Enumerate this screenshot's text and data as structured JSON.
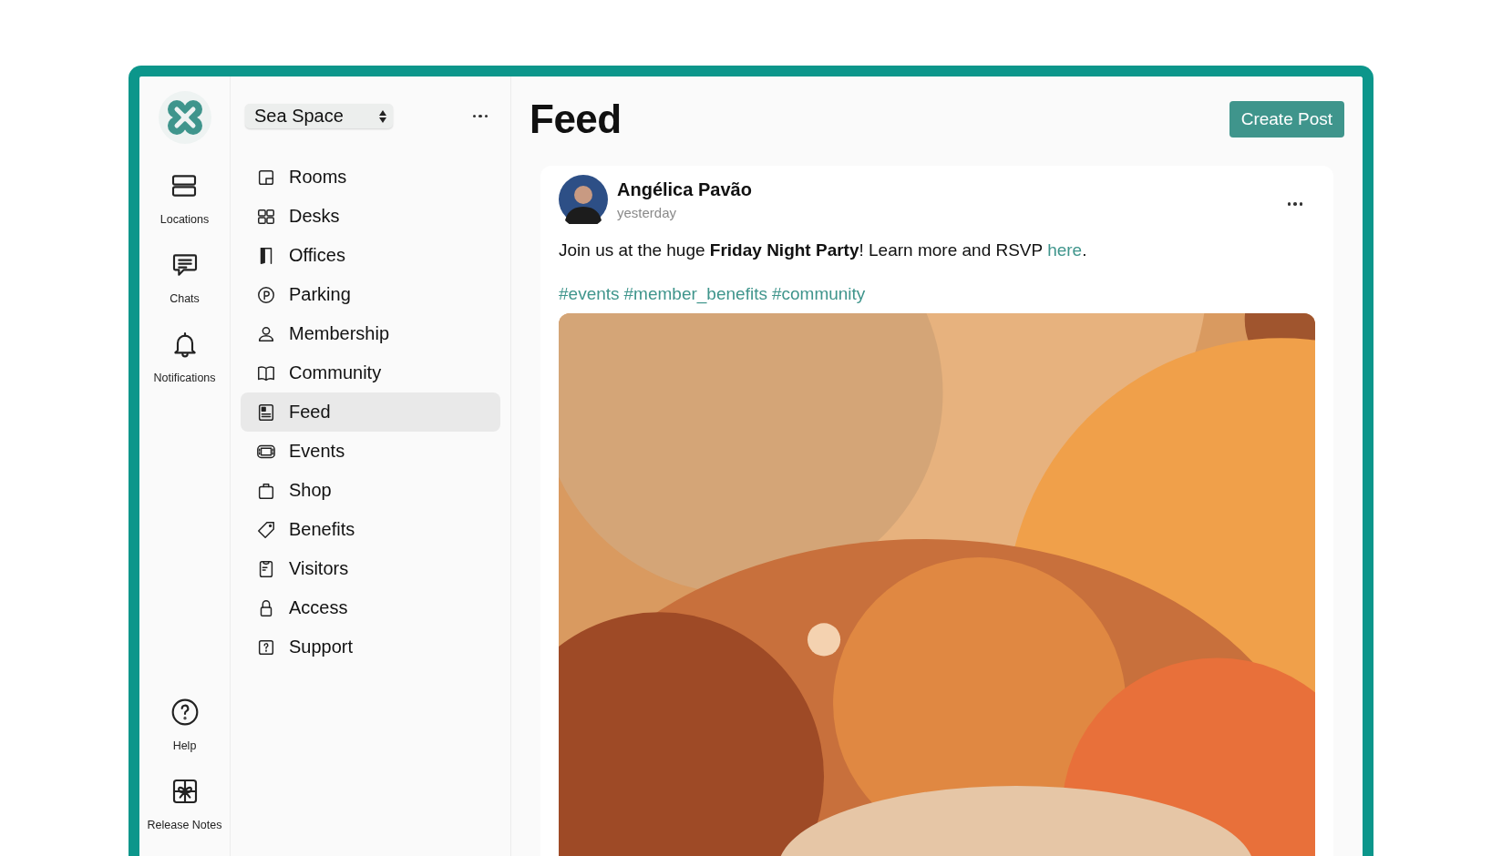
{
  "rail": {
    "top": [
      {
        "label": "Locations"
      },
      {
        "label": "Chats"
      },
      {
        "label": "Notifications"
      }
    ],
    "bottom": [
      {
        "label": "Help"
      },
      {
        "label": "Release Notes"
      }
    ]
  },
  "workspace": {
    "value": "Sea Space"
  },
  "nav": [
    {
      "label": "Rooms",
      "selected": false
    },
    {
      "label": "Desks",
      "selected": false
    },
    {
      "label": "Offices",
      "selected": false
    },
    {
      "label": "Parking",
      "selected": false
    },
    {
      "label": "Membership",
      "selected": false
    },
    {
      "label": "Community",
      "selected": false
    },
    {
      "label": "Feed",
      "selected": true
    },
    {
      "label": "Events",
      "selected": false
    },
    {
      "label": "Shop",
      "selected": false
    },
    {
      "label": "Benefits",
      "selected": false
    },
    {
      "label": "Visitors",
      "selected": false
    },
    {
      "label": "Access",
      "selected": false
    },
    {
      "label": "Support",
      "selected": false
    }
  ],
  "main": {
    "title": "Feed",
    "create_button": "Create Post"
  },
  "post": {
    "author": "Angélica Pavão",
    "time": "yesterday",
    "message": "Join us at the huge **Friday Night Party**! Learn more and RSVP ",
    "link": "here",
    "message_end": ".",
    "hashtags": [
      "#events",
      "#member_benefits",
      "#community"
    ]
  }
}
